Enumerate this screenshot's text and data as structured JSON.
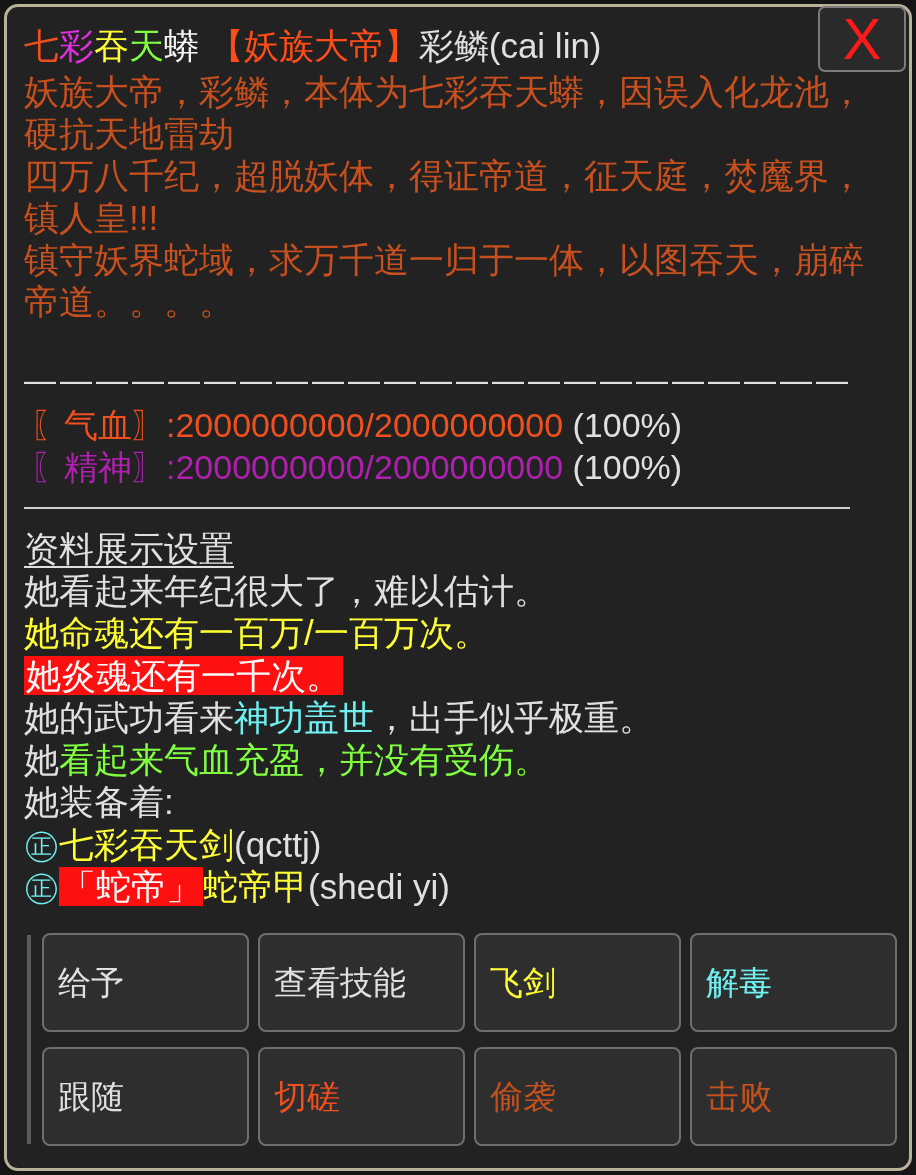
{
  "close_button": {
    "label": "X"
  },
  "title": {
    "segments": [
      {
        "text": "七",
        "color": "#f0501e"
      },
      {
        "text": "彩",
        "color": "#e030e0"
      },
      {
        "text": "吞",
        "color": "#ffff33"
      },
      {
        "text": "天",
        "color": "#80ff40"
      },
      {
        "text": "蟒",
        "color": "#f4f4f4"
      },
      {
        "text": " 【妖族大帝】",
        "color": "#ff4d1a"
      },
      {
        "text": "彩鳞(cai lin)",
        "color": "#e0e0e0"
      }
    ]
  },
  "description": [
    "妖族大帝，彩鳞，本体为七彩吞天蟒，因误入化龙池，硬抗天地雷劫",
    "四万八千纪，超脱妖体，得证帝道，征天庭，焚魔界，镇人皇!!!",
    "镇守妖界蛇域，求万千道一归于一体，以图吞天，崩碎帝道。。。。"
  ],
  "divider": "———————————————————————",
  "stats": [
    {
      "label": "〖气血〗",
      "value": ":2000000000/2000000000",
      "percent": "(100%)",
      "color": "#f0501e"
    },
    {
      "label": "〖精神〗",
      "value": ":2000000000/2000000000",
      "percent": "(100%)",
      "color": "#b020b0"
    }
  ],
  "settings_link": "资料展示设置",
  "info_lines": [
    {
      "segments": [
        {
          "text": "她看起来年纪很大了，难以估计。",
          "color": "#e0e0e0",
          "highlighted": false
        }
      ]
    },
    {
      "segments": [
        {
          "text": "她命魂还有一百万/一百万次。",
          "color": "#ffff33",
          "highlighted": false
        }
      ]
    },
    {
      "segments": [
        {
          "text": "她炎魂还有一千次。",
          "highlighted": true
        }
      ]
    },
    {
      "segments": [
        {
          "text": "她的武功看来",
          "color": "#e0e0e0",
          "highlighted": false
        },
        {
          "text": "神功盖世",
          "color": "#70f0f0",
          "highlighted": false
        },
        {
          "text": "，出手似乎极重。",
          "color": "#e0e0e0",
          "highlighted": false
        }
      ]
    },
    {
      "segments": [
        {
          "text": "她",
          "color": "#e0e0e0",
          "highlighted": false
        },
        {
          "text": "看起来气血充盈，并没有受伤。",
          "color": "#80ff40",
          "highlighted": false
        }
      ]
    },
    {
      "segments": [
        {
          "text": "她装备着:",
          "color": "#e0e0e0",
          "highlighted": false
        }
      ]
    }
  ],
  "equipment": [
    {
      "segments": [
        {
          "text": "㊣",
          "color": "#70f0f0",
          "highlighted": false
        },
        {
          "text": "七彩吞天剑",
          "color": "#ffff33",
          "highlighted": false
        },
        {
          "text": "(qcttj)",
          "color": "#e0e0e0",
          "highlighted": false
        }
      ]
    },
    {
      "segments": [
        {
          "text": "㊣",
          "color": "#70f0f0",
          "highlighted": false
        },
        {
          "text": "「蛇帝」",
          "highlighted": true
        },
        {
          "text": "蛇帝甲",
          "color": "#ffff33",
          "highlighted": false
        },
        {
          "text": "(shedi yi)",
          "color": "#e0e0e0",
          "highlighted": false
        }
      ]
    }
  ],
  "buttons": [
    {
      "label": "给予",
      "color": "#e0e0e0"
    },
    {
      "label": "查看技能",
      "color": "#e0e0e0"
    },
    {
      "label": "飞剑",
      "color": "#ffff33"
    },
    {
      "label": "解毒",
      "color": "#70f0f0"
    },
    {
      "label": "跟随",
      "color": "#e0e0e0"
    },
    {
      "label": "切磋",
      "color": "#f0501e"
    },
    {
      "label": "偷袭",
      "color": "#c4501c"
    },
    {
      "label": "击败",
      "color": "#c4501c"
    }
  ]
}
